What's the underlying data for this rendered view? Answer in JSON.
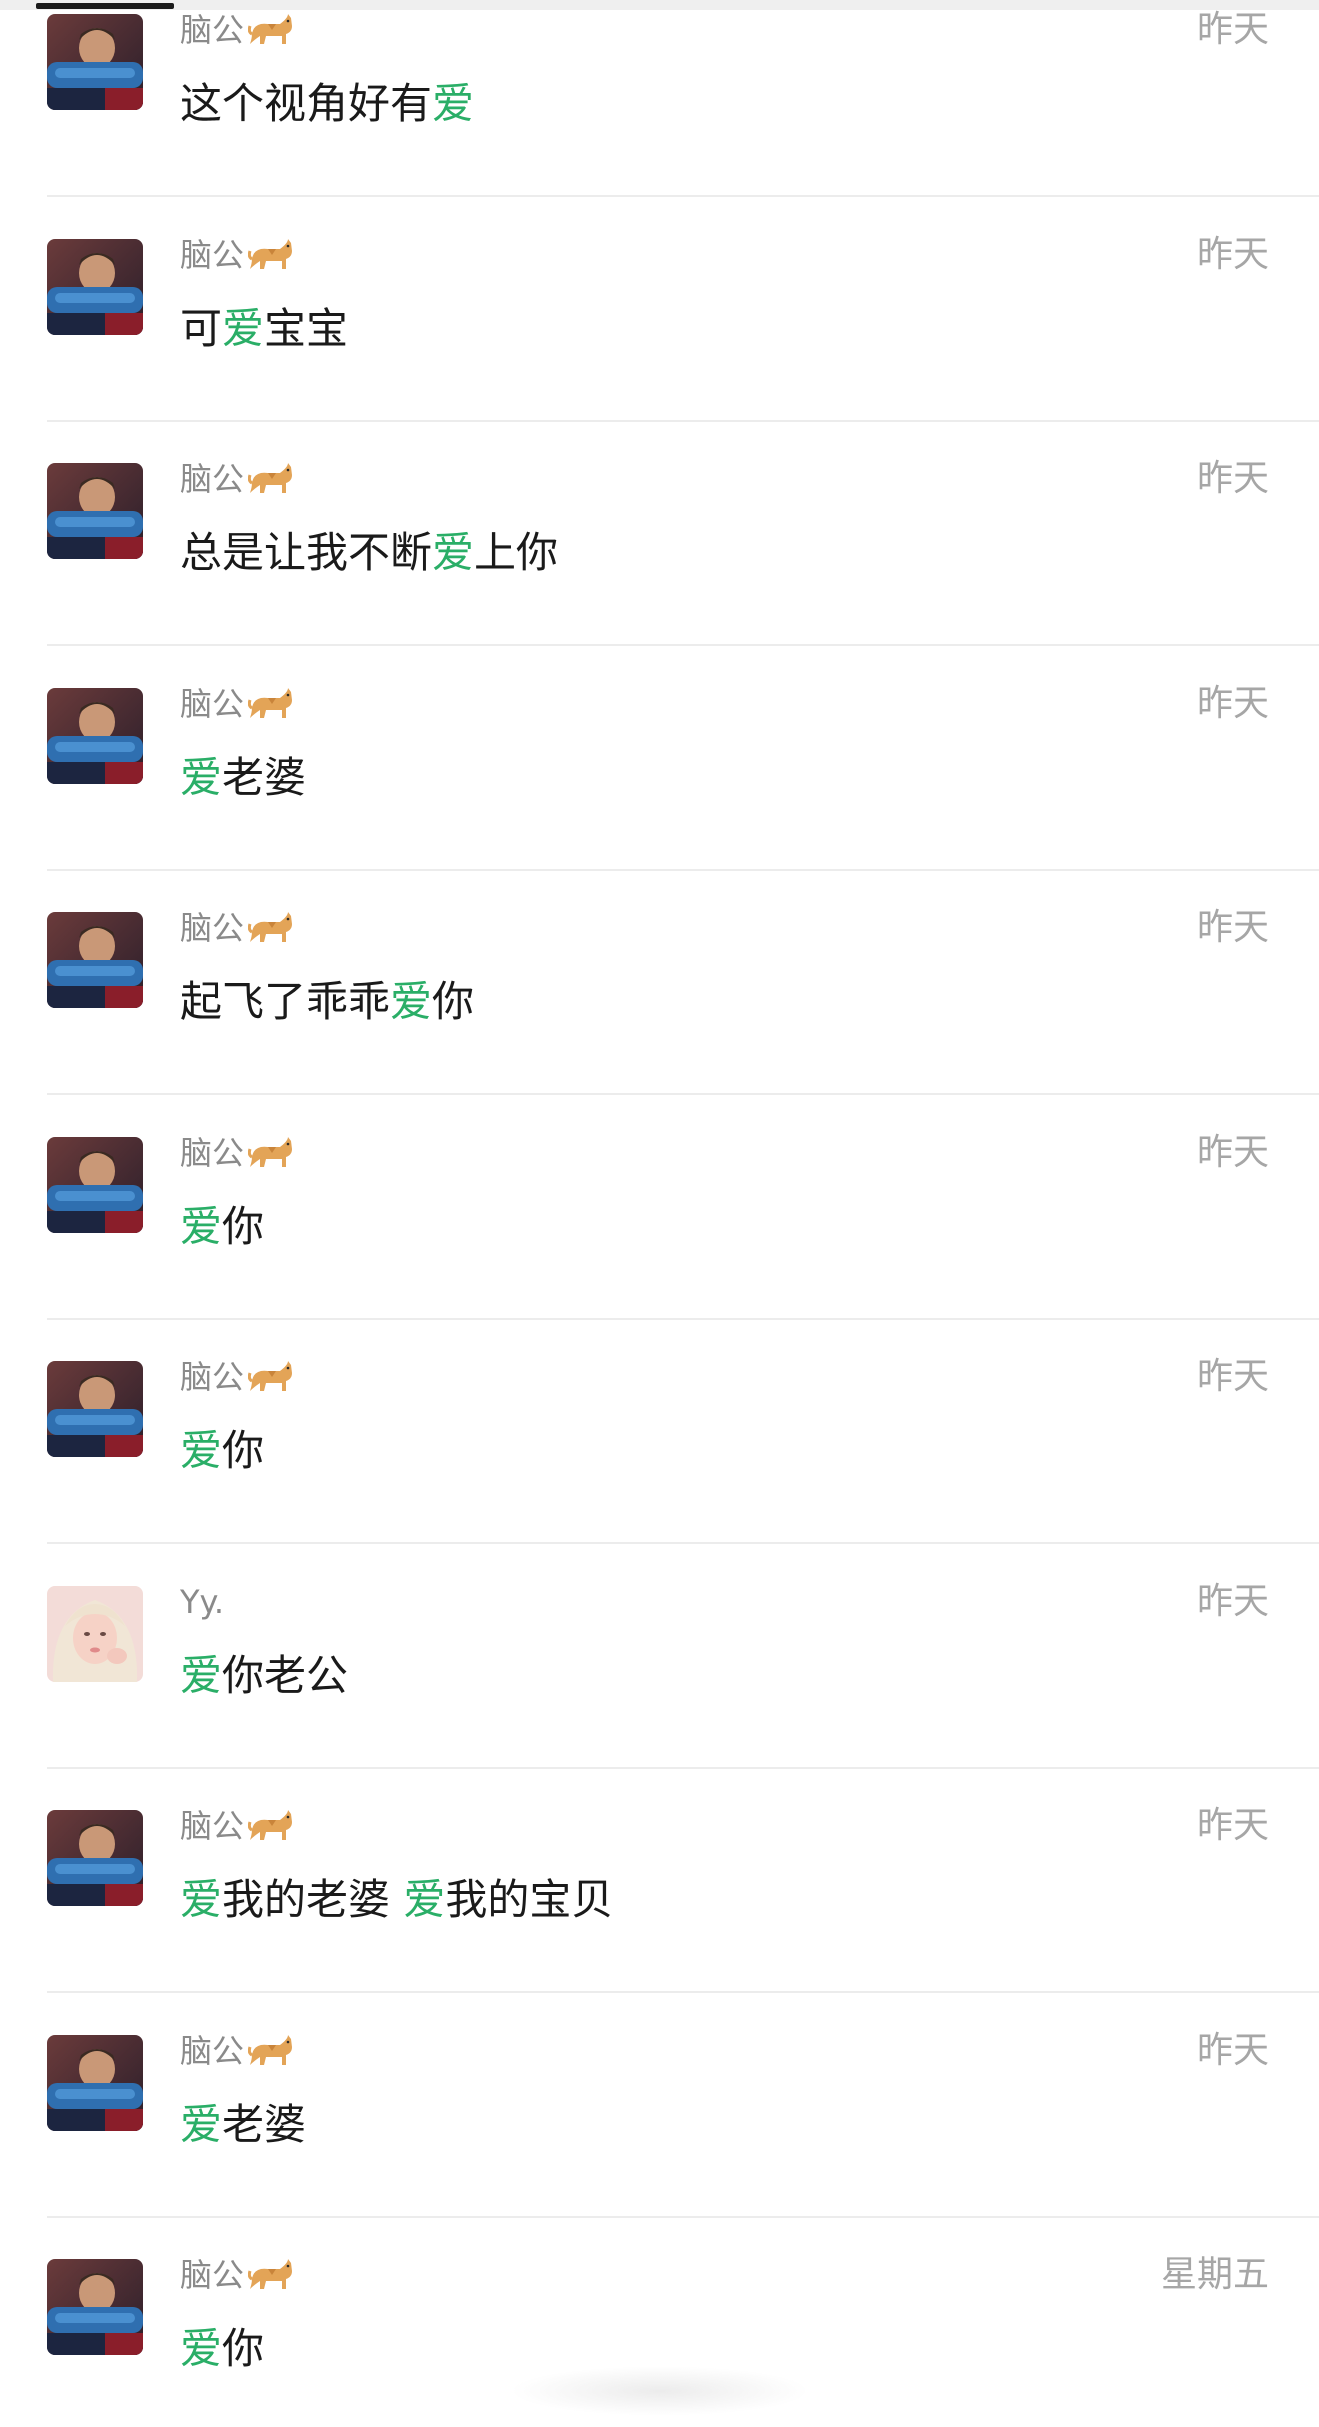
{
  "colors": {
    "highlight": "#2aae67",
    "name": "#8a8a8a",
    "time": "#a6a6a6",
    "text": "#1a1a1a",
    "divider": "#ececec"
  },
  "items": [
    {
      "avatar": "man-avatar",
      "name": "脑公",
      "name_icon": "cat-icon",
      "time": "昨天",
      "message": [
        {
          "t": "这个视角好有",
          "h": false
        },
        {
          "t": "爱",
          "h": true
        }
      ]
    },
    {
      "avatar": "man-avatar",
      "name": "脑公",
      "name_icon": "cat-icon",
      "time": "昨天",
      "message": [
        {
          "t": "可",
          "h": false
        },
        {
          "t": "爱",
          "h": true
        },
        {
          "t": "宝宝",
          "h": false
        }
      ]
    },
    {
      "avatar": "man-avatar",
      "name": "脑公",
      "name_icon": "cat-icon",
      "time": "昨天",
      "message": [
        {
          "t": "总是让我不断",
          "h": false
        },
        {
          "t": "爱",
          "h": true
        },
        {
          "t": "上你",
          "h": false
        }
      ]
    },
    {
      "avatar": "man-avatar",
      "name": "脑公",
      "name_icon": "cat-icon",
      "time": "昨天",
      "message": [
        {
          "t": "爱",
          "h": true
        },
        {
          "t": "老婆",
          "h": false
        }
      ]
    },
    {
      "avatar": "man-avatar",
      "name": "脑公",
      "name_icon": "cat-icon",
      "time": "昨天",
      "message": [
        {
          "t": "起飞了乖乖",
          "h": false
        },
        {
          "t": "爱",
          "h": true
        },
        {
          "t": "你",
          "h": false
        }
      ]
    },
    {
      "avatar": "man-avatar",
      "name": "脑公",
      "name_icon": "cat-icon",
      "time": "昨天",
      "message": [
        {
          "t": "爱",
          "h": true
        },
        {
          "t": "你",
          "h": false
        }
      ]
    },
    {
      "avatar": "man-avatar",
      "name": "脑公",
      "name_icon": "cat-icon",
      "time": "昨天",
      "message": [
        {
          "t": "爱",
          "h": true
        },
        {
          "t": "你",
          "h": false
        }
      ]
    },
    {
      "avatar": "woman-avatar",
      "name": "Yy.",
      "name_icon": "",
      "time": "昨天",
      "message": [
        {
          "t": "爱",
          "h": true
        },
        {
          "t": "你老公",
          "h": false
        }
      ]
    },
    {
      "avatar": "man-avatar",
      "name": "脑公",
      "name_icon": "cat-icon",
      "time": "昨天",
      "message": [
        {
          "t": "爱",
          "h": true
        },
        {
          "t": "我的老婆 ",
          "h": false
        },
        {
          "t": "爱",
          "h": true
        },
        {
          "t": "我的宝贝",
          "h": false
        }
      ]
    },
    {
      "avatar": "man-avatar",
      "name": "脑公",
      "name_icon": "cat-icon",
      "time": "昨天",
      "message": [
        {
          "t": "爱",
          "h": true
        },
        {
          "t": "老婆",
          "h": false
        }
      ]
    },
    {
      "avatar": "man-avatar",
      "name": "脑公",
      "name_icon": "cat-icon",
      "time": "星期五",
      "message": [
        {
          "t": "爱",
          "h": true
        },
        {
          "t": "你",
          "h": false
        }
      ]
    }
  ]
}
